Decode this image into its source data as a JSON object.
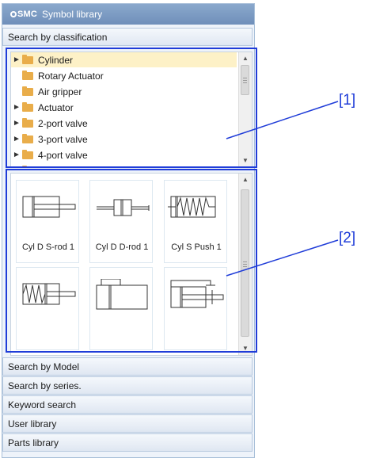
{
  "title_bar": {
    "logo": "SMC",
    "title": "Symbol library"
  },
  "sections": {
    "classification": "Search by classification",
    "model": "Search by Model",
    "series": "Search by series.",
    "keyword": "Keyword search",
    "user_library": "User library",
    "parts_library": "Parts library"
  },
  "tree": {
    "items": [
      {
        "label": "Cylinder",
        "expandable": true,
        "selected": true
      },
      {
        "label": "Rotary Actuator",
        "expandable": false
      },
      {
        "label": "Air gripper",
        "expandable": false
      },
      {
        "label": "Actuator",
        "expandable": true
      },
      {
        "label": "2-port valve",
        "expandable": true
      },
      {
        "label": "3-port valve",
        "expandable": true
      },
      {
        "label": "4-port valve",
        "expandable": true
      }
    ]
  },
  "symbols": {
    "tiles": [
      {
        "label": "Cyl D S-rod 1",
        "icon": "cylinder-double-single-rod-icon"
      },
      {
        "label": "Cyl D D-rod 1",
        "icon": "cylinder-double-double-rod-icon"
      },
      {
        "label": "Cyl S Push 1",
        "icon": "cylinder-single-push-icon"
      },
      {
        "label": "",
        "icon": "cylinder-single-pull-icon"
      },
      {
        "label": "",
        "icon": "rodless-cylinder-icon"
      },
      {
        "label": "",
        "icon": "cylinder-with-lock-icon"
      }
    ]
  },
  "callouts": {
    "tree": "[1]",
    "symbols": "[2]"
  },
  "colors": {
    "callout": "#1f3cd8",
    "title_bar": "#7a98c2",
    "selected_row": "#fdf1c7",
    "folder": "#e9ad4a"
  }
}
